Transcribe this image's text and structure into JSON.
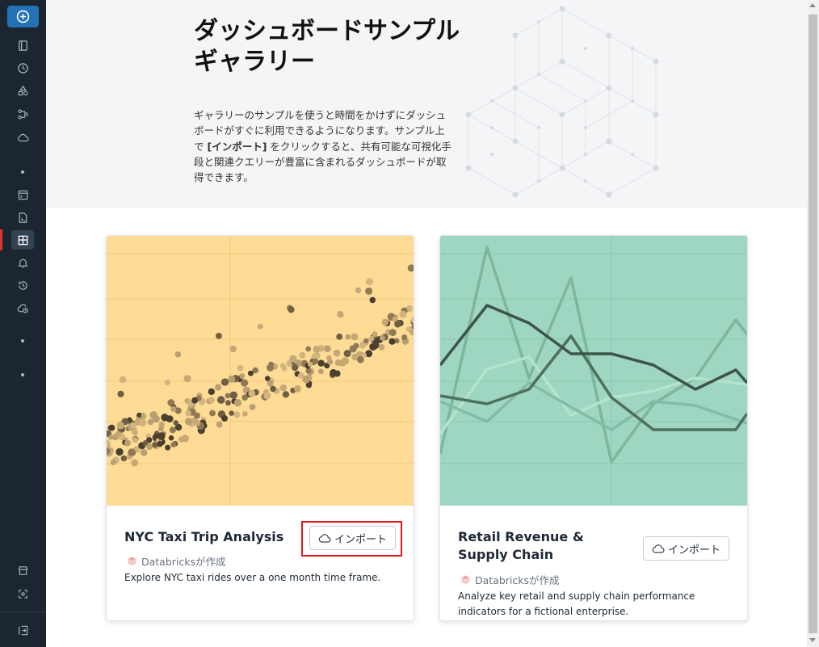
{
  "sidebar": {
    "new_button_icon": "plus-circle-icon",
    "items": [
      {
        "name": "workspace-icon"
      },
      {
        "name": "recents-icon"
      },
      {
        "name": "catalog-icon"
      },
      {
        "name": "workflows-icon"
      },
      {
        "name": "compute-icon"
      },
      {
        "name": "sql-editor-icon"
      },
      {
        "name": "queries-icon"
      },
      {
        "name": "dashboards-icon"
      },
      {
        "name": "alerts-icon"
      },
      {
        "name": "query-history-icon"
      },
      {
        "name": "sql-warehouses-icon"
      },
      {
        "name": "marketplace-icon"
      },
      {
        "name": "partner-connect-icon"
      },
      {
        "name": "collapse-sidebar-icon"
      }
    ],
    "active_item": "dashboards-icon",
    "accent_color": "#e0332b"
  },
  "hero": {
    "title": "ダッシュボードサンプルギャラリー",
    "desc_part1": "ギャラリーのサンプルを使うと時間をかけずにダッシュボードがすぐに利用できるようになります。サンプル上で ",
    "desc_bold": "[インポート]",
    "desc_part2": " をクリックすると、共有可能な可視化手段と関連クエリーが豊富に含まれるダッシュボードが取得できます。"
  },
  "cards": [
    {
      "title": "NYC Taxi Trip Analysis",
      "import_label": "インポート",
      "author": "Databricksが作成",
      "description": "Explore NYC taxi rides over a one month time frame.",
      "preview_color": "#fedc96"
    },
    {
      "title": "Retail Revenue & Supply Chain",
      "import_label": "インポート",
      "author": "Databricksが作成",
      "description": "Analyze key retail and supply chain performance indicators for a fictional enterprise.",
      "preview_color": "#9ed6c1"
    }
  ],
  "colors": {
    "sidebar_bg": "#1b2631",
    "primary": "#2272b4",
    "highlight": "#e8151b"
  }
}
